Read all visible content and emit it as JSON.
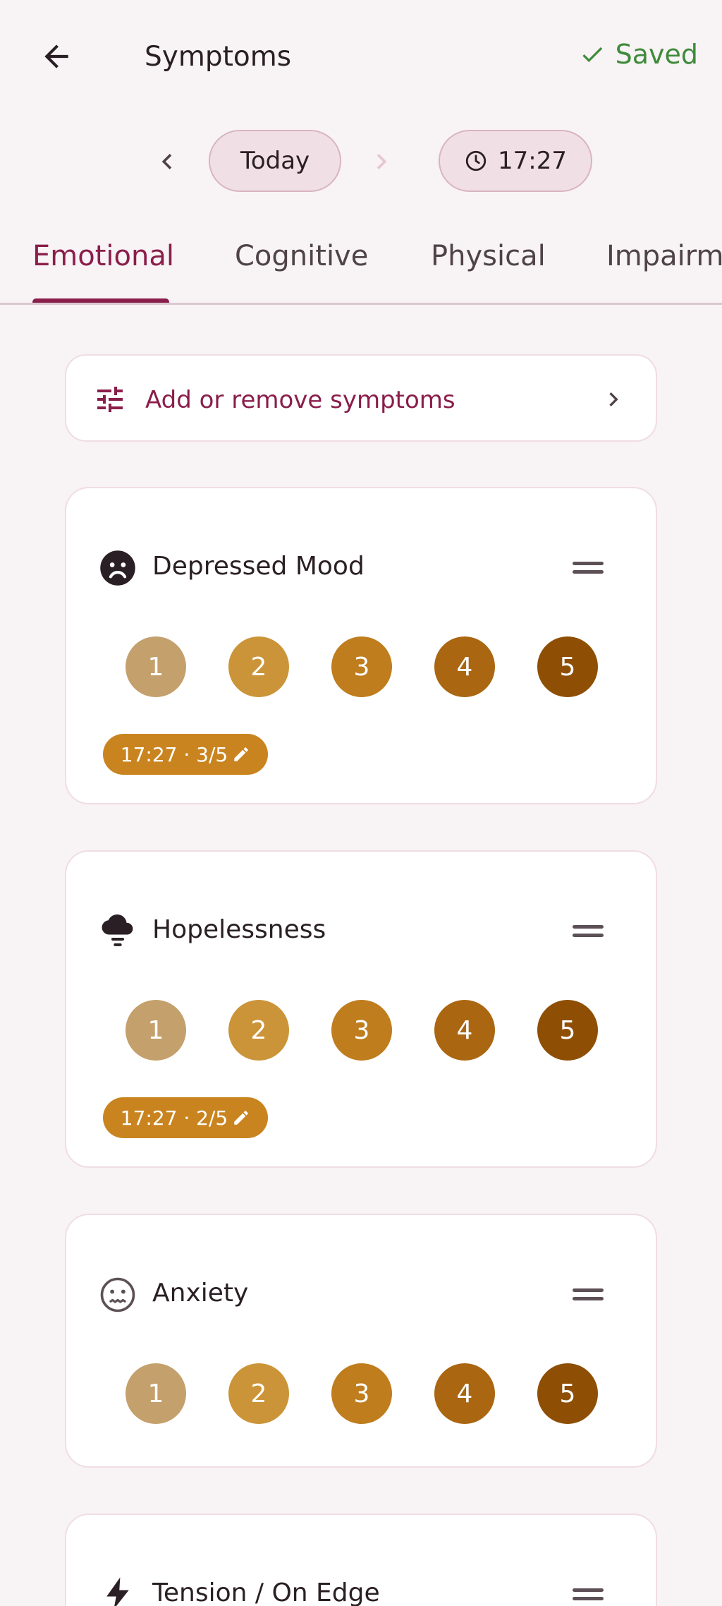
{
  "header": {
    "title": "Symptoms",
    "saved_label": "Saved",
    "back_icon": "arrow-left-icon",
    "saved_icon": "check-icon",
    "saved_color": "#3e8b3a"
  },
  "datebar": {
    "day_label": "Today",
    "time_label": "17:27",
    "prev_icon": "chevron-left-icon",
    "next_icon": "chevron-right-icon",
    "time_icon": "clock-icon"
  },
  "tabs": [
    {
      "label": "Emotional",
      "active": true
    },
    {
      "label": "Cognitive",
      "active": false
    },
    {
      "label": "Physical",
      "active": false
    },
    {
      "label": "Impairment",
      "active": false
    }
  ],
  "add_symptoms": {
    "label": "Add or remove symptoms",
    "icon": "tune-icon",
    "chevron": "chevron-right-icon"
  },
  "scale": [
    "1",
    "2",
    "3",
    "4",
    "5"
  ],
  "scale_colors": [
    "#c4a06c",
    "#cb9438",
    "#bf7d1e",
    "#aa6610",
    "#8e4f04"
  ],
  "accent": "#8a1e4a",
  "symptoms": [
    {
      "name": "Depressed Mood",
      "icon": "sad-face-icon",
      "entry": "17:27 · 3/5"
    },
    {
      "name": "Hopelessness",
      "icon": "storm-cloud-icon",
      "entry": "17:27 · 2/5"
    },
    {
      "name": "Anxiety",
      "icon": "anxious-face-icon",
      "entry": null
    },
    {
      "name": "Tension / On Edge",
      "icon": "lightning-icon",
      "entry": null
    }
  ]
}
